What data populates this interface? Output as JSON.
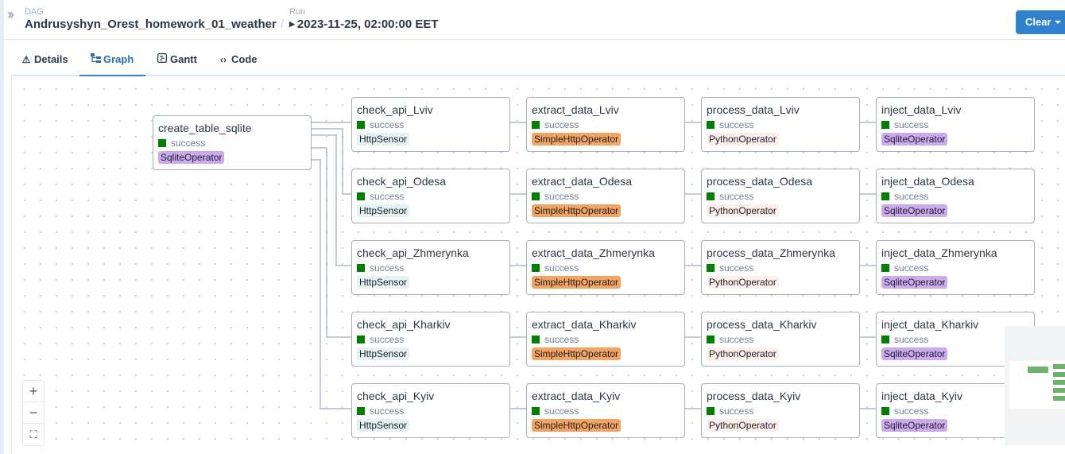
{
  "header": {
    "dag_label": "DAG",
    "dag_name": "Andrusyshyn_Orest_homework_01_weather",
    "separator": "/",
    "run_label": "Run",
    "run_value": "2023-11-25, 02:00:00 EET",
    "clear_label": "Clear"
  },
  "tabs": [
    {
      "label": "Details",
      "icon": "warning-icon"
    },
    {
      "label": "Graph",
      "icon": "graph-icon",
      "active": true
    },
    {
      "label": "Gantt",
      "icon": "gantt-icon"
    },
    {
      "label": "Code",
      "icon": "code-icon"
    }
  ],
  "colors": {
    "success": "#008000",
    "accent": "#3182ce",
    "HttpSensor": "#e6f1f2",
    "SimpleHttpOperator": "#f4a460",
    "PythonOperator": "#ffefeb",
    "SqliteOperator": "#cdaaed"
  },
  "graph": {
    "root": {
      "title": "create_table_sqlite",
      "state": "success",
      "operator": "SqliteOperator"
    },
    "rows": [
      {
        "tasks": [
          {
            "title": "check_api_Lviv",
            "state": "success",
            "operator": "HttpSensor"
          },
          {
            "title": "extract_data_Lviv",
            "state": "success",
            "operator": "SimpleHttpOperator"
          },
          {
            "title": "process_data_Lviv",
            "state": "success",
            "operator": "PythonOperator"
          },
          {
            "title": "inject_data_Lviv",
            "state": "success",
            "operator": "SqliteOperator"
          }
        ]
      },
      {
        "tasks": [
          {
            "title": "check_api_Odesa",
            "state": "success",
            "operator": "HttpSensor"
          },
          {
            "title": "extract_data_Odesa",
            "state": "success",
            "operator": "SimpleHttpOperator"
          },
          {
            "title": "process_data_Odesa",
            "state": "success",
            "operator": "PythonOperator"
          },
          {
            "title": "inject_data_Odesa",
            "state": "success",
            "operator": "SqliteOperator"
          }
        ]
      },
      {
        "tasks": [
          {
            "title": "check_api_Zhmerynka",
            "state": "success",
            "operator": "HttpSensor"
          },
          {
            "title": "extract_data_Zhmerynka",
            "state": "success",
            "operator": "SimpleHttpOperator"
          },
          {
            "title": "process_data_Zhmerynka",
            "state": "success",
            "operator": "PythonOperator"
          },
          {
            "title": "inject_data_Zhmerynka",
            "state": "success",
            "operator": "SqliteOperator"
          }
        ]
      },
      {
        "tasks": [
          {
            "title": "check_api_Kharkiv",
            "state": "success",
            "operator": "HttpSensor"
          },
          {
            "title": "extract_data_Kharkiv",
            "state": "success",
            "operator": "SimpleHttpOperator"
          },
          {
            "title": "process_data_Kharkiv",
            "state": "success",
            "operator": "PythonOperator"
          },
          {
            "title": "inject_data_Kharkiv",
            "state": "success",
            "operator": "SqliteOperator"
          }
        ]
      },
      {
        "tasks": [
          {
            "title": "check_api_Kyiv",
            "state": "success",
            "operator": "HttpSensor"
          },
          {
            "title": "extract_data_Kyiv",
            "state": "success",
            "operator": "SimpleHttpOperator"
          },
          {
            "title": "process_data_Kyiv",
            "state": "success",
            "operator": "PythonOperator"
          },
          {
            "title": "inject_data_Kyiv",
            "state": "success",
            "operator": "SqliteOperator"
          }
        ]
      }
    ]
  },
  "controls": {
    "zoom_in": "+",
    "zoom_out": "−",
    "fit_view": "⛶"
  }
}
